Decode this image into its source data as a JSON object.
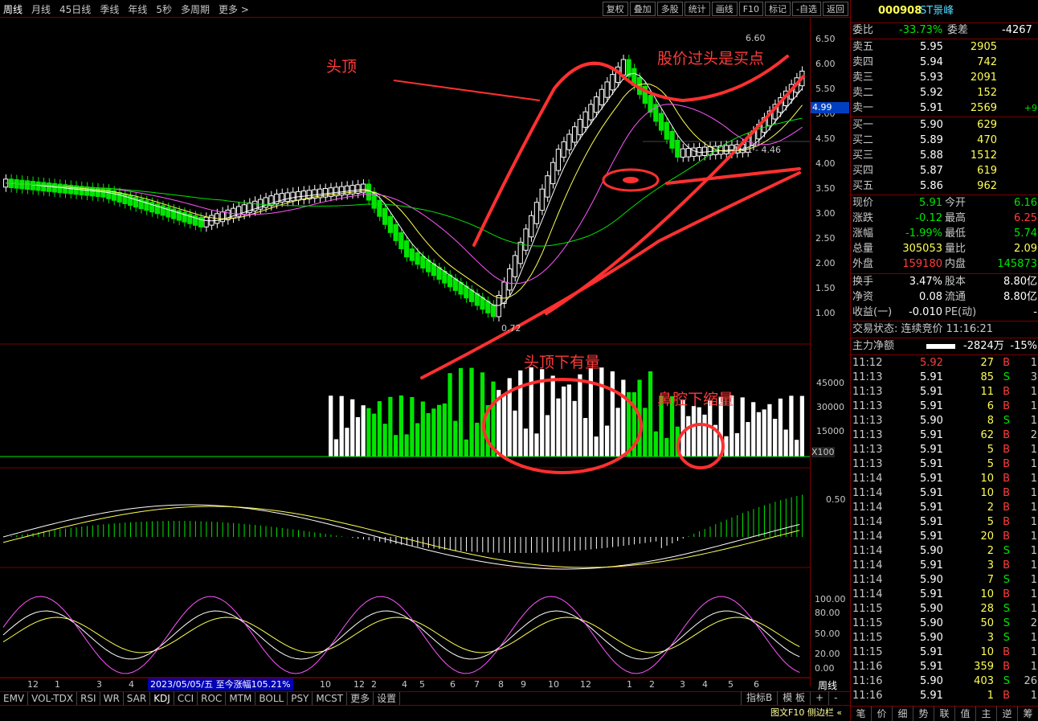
{
  "toolbar": {
    "left": [
      "周线",
      "月线",
      "45日线",
      "季线",
      "年线",
      "5秒",
      "多周期",
      "更多 >"
    ],
    "right": [
      "复权",
      "叠加",
      "多股",
      "统计",
      "画线",
      "F10",
      "标记",
      "-自选",
      "返回"
    ]
  },
  "price_axis": [
    "6.50",
    "6.00",
    "5.50",
    "5.00",
    "4.50",
    "4.00",
    "3.50",
    "3.00",
    "2.50",
    "2.00",
    "1.50",
    "1.00"
  ],
  "price_tag": "4.99",
  "chart_labels": {
    "high": "6.60",
    "low": "0.72",
    "mid": "4.41 - 4.46"
  },
  "vol_axis": [
    "45000",
    "30000",
    "15000",
    "X100"
  ],
  "macd_axis": [
    "0.50"
  ],
  "kdj_axis": [
    "100.00",
    "80.00",
    "50.00",
    "20.00",
    "0.00"
  ],
  "annotations": {
    "head": "头顶",
    "buy": "股价过头是买点",
    "vol_head": "头顶下有量",
    "vol_nose": "鼻腔下缩量"
  },
  "xaxis": [
    "12",
    "1",
    "3",
    "4",
    "5",
    "6",
    "7",
    "8",
    "9",
    "10",
    "12",
    "2",
    "3",
    "4",
    "5",
    "6",
    "12",
    "1",
    "2",
    "4",
    "5",
    "6",
    "7",
    "8",
    "9",
    "10",
    "11",
    "12",
    "1",
    "2",
    "3",
    "4",
    "5",
    "6"
  ],
  "xaxis_date": "2023/05/05/五  至今涨幅105.21%",
  "xaxis_period": "周线",
  "indicator_tabs": [
    "EMV",
    "VOL-TDX",
    "RSI",
    "WR",
    "SAR",
    "KDJ",
    "CCI",
    "ROC",
    "MTM",
    "BOLL",
    "PSY",
    "MCST",
    "更多",
    "设置"
  ],
  "bottom_right": [
    "指标B",
    "模 板",
    "+",
    "-"
  ],
  "stock": {
    "code": "000908",
    "name": "ST景峰"
  },
  "order": {
    "wb_label": "委比",
    "wb": "-33.73%",
    "wc_label": "委差",
    "wc": "-4267"
  },
  "asks": [
    {
      "l": "卖五",
      "p": "5.95",
      "v": "2905"
    },
    {
      "l": "卖四",
      "p": "5.94",
      "v": "742"
    },
    {
      "l": "卖三",
      "p": "5.93",
      "v": "2091"
    },
    {
      "l": "卖二",
      "p": "5.92",
      "v": "152"
    },
    {
      "l": "卖一",
      "p": "5.91",
      "v": "2569",
      "x": "+9"
    }
  ],
  "bids": [
    {
      "l": "买一",
      "p": "5.90",
      "v": "629"
    },
    {
      "l": "买二",
      "p": "5.89",
      "v": "470"
    },
    {
      "l": "买三",
      "p": "5.88",
      "v": "1512"
    },
    {
      "l": "买四",
      "p": "5.87",
      "v": "619"
    },
    {
      "l": "买五",
      "p": "5.86",
      "v": "962"
    }
  ],
  "quote": [
    {
      "a": "现价",
      "av": "5.91",
      "b": "今开",
      "bv": "6.16"
    },
    {
      "a": "涨跌",
      "av": "-0.12",
      "b": "最高",
      "bv": "6.25"
    },
    {
      "a": "涨幅",
      "av": "-1.99%",
      "b": "最低",
      "bv": "5.74"
    },
    {
      "a": "总量",
      "av": "305053",
      "b": "量比",
      "bv": "2.09"
    },
    {
      "a": "外盘",
      "av": "159180",
      "b": "内盘",
      "bv": "145873"
    }
  ],
  "finance": [
    {
      "a": "换手",
      "av": "3.47%",
      "b": "股本",
      "bv": "8.80亿"
    },
    {
      "a": "净资",
      "av": "0.08",
      "b": "流通",
      "bv": "8.80亿"
    },
    {
      "a": "收益(一)",
      "av": "-0.010",
      "b": "PE(动)",
      "bv": "-"
    }
  ],
  "status": "交易状态: 连续竞价 11:16:21",
  "netflow": {
    "label": "主力净额",
    "value": "-2824万",
    "pct": "-15%"
  },
  "ticks": [
    [
      "11:12",
      "5.92",
      "27",
      "B",
      "1"
    ],
    [
      "11:13",
      "5.91",
      "85",
      "S",
      "3"
    ],
    [
      "11:13",
      "5.91",
      "11",
      "B",
      "1"
    ],
    [
      "11:13",
      "5.91",
      "6",
      "B",
      "1"
    ],
    [
      "11:13",
      "5.90",
      "8",
      "S",
      "1"
    ],
    [
      "11:13",
      "5.91",
      "62",
      "B",
      "2"
    ],
    [
      "11:13",
      "5.91",
      "5",
      "B",
      "1"
    ],
    [
      "11:13",
      "5.91",
      "5",
      "B",
      "1"
    ],
    [
      "11:14",
      "5.91",
      "10",
      "B",
      "1"
    ],
    [
      "11:14",
      "5.91",
      "10",
      "B",
      "1"
    ],
    [
      "11:14",
      "5.91",
      "2",
      "B",
      "1"
    ],
    [
      "11:14",
      "5.91",
      "5",
      "B",
      "1"
    ],
    [
      "11:14",
      "5.91",
      "20",
      "B",
      "1"
    ],
    [
      "11:14",
      "5.90",
      "2",
      "S",
      "1"
    ],
    [
      "11:14",
      "5.91",
      "3",
      "B",
      "1"
    ],
    [
      "11:14",
      "5.90",
      "7",
      "S",
      "1"
    ],
    [
      "11:14",
      "5.91",
      "10",
      "B",
      "1"
    ],
    [
      "11:15",
      "5.90",
      "28",
      "S",
      "1"
    ],
    [
      "11:15",
      "5.90",
      "50",
      "S",
      "2"
    ],
    [
      "11:15",
      "5.90",
      "3",
      "S",
      "1"
    ],
    [
      "11:15",
      "5.91",
      "10",
      "B",
      "1"
    ],
    [
      "11:16",
      "5.91",
      "359",
      "B",
      "1"
    ],
    [
      "11:16",
      "5.90",
      "403",
      "S",
      "26"
    ],
    [
      "11:16",
      "5.91",
      "1",
      "B",
      "1"
    ]
  ],
  "right_tabs": [
    "笔",
    "价",
    "细",
    "势",
    "联",
    "值",
    "主",
    "逆",
    "筹"
  ],
  "right_footer": "图文F10 侧边栏 «",
  "colors": {
    "up": "#ff3c3c",
    "down": "#00e600",
    "bar_up": "#ffffff",
    "bar_down": "#00e600"
  }
}
